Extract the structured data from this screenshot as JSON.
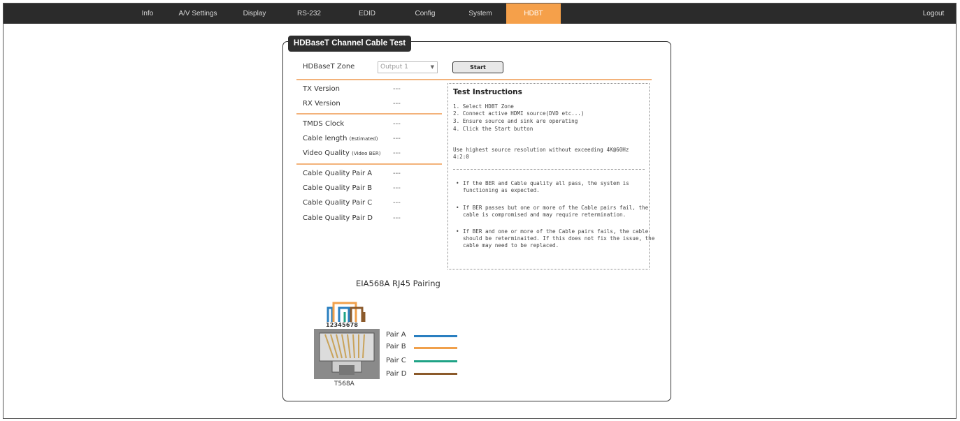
{
  "nav": {
    "items": [
      "Info",
      "A/V Settings",
      "Display",
      "RS-232",
      "EDID",
      "Config",
      "System",
      "HDBT"
    ],
    "active": "HDBT",
    "logout": "Logout"
  },
  "panel": {
    "title": "HDBaseT Channel Cable Test",
    "zone_label": "HDBaseT Zone",
    "zone_value": "Output 1",
    "start_label": "Start",
    "fields": [
      {
        "label": "TX Version",
        "value": "---"
      },
      {
        "label": "RX Version",
        "value": "---"
      },
      {
        "label": "TMDS Clock",
        "value": "---"
      },
      {
        "label": "Cable length",
        "sub": "(Estimated)",
        "value": "---"
      },
      {
        "label": "Video Quality",
        "sub": "(Video BER)",
        "value": "---"
      },
      {
        "label": "Cable Quality Pair A",
        "value": "---"
      },
      {
        "label": "Cable Quality Pair B",
        "value": "---"
      },
      {
        "label": "Cable Quality Pair C",
        "value": "---"
      },
      {
        "label": "Cable Quality Pair D",
        "value": "---"
      }
    ]
  },
  "instructions": {
    "title": "Test Instructions",
    "steps": [
      "1. Select HDBT Zone",
      "2. Connect active HDMI source(DVD etc...)",
      "3. Ensure source and sink are operating",
      "4. Click the Start button"
    ],
    "note_line1": "Use highest source resolution without exceeding 4K@60Hz",
    "note_line2": "4:2:0",
    "bullets": [
      "If the BER and Cable quality all pass, the system is functioning as expected.",
      "If BER passes but one or more of the Cable pairs fail, the cable is compromised and may require retermination.",
      "If BER and one or more of the Cable pairs fails, the cable should be reterminaited. If this does not fix the issue, the cable may need to be replaced."
    ]
  },
  "rj45": {
    "title": "EIA568A RJ45 Pairing",
    "pin_numbers": "12345678",
    "standard": "T568A",
    "pairs": [
      {
        "label": "Pair A",
        "color": "#2a7fc0"
      },
      {
        "label": "Pair B",
        "color": "#f0a04b"
      },
      {
        "label": "Pair C",
        "color": "#1fa386"
      },
      {
        "label": "Pair D",
        "color": "#8b5a2b"
      }
    ]
  }
}
